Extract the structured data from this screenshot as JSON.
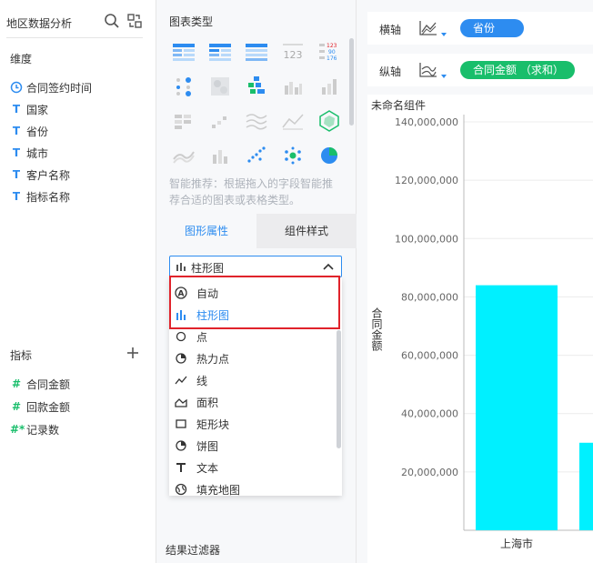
{
  "left": {
    "title": "地区数据分析",
    "dimensions_label": "维度",
    "dimensions": [
      {
        "name": "合同签约时间",
        "type": "clock-icon"
      },
      {
        "name": "国家",
        "type": "text-type-icon"
      },
      {
        "name": "省份",
        "type": "text-type-icon"
      },
      {
        "name": "城市",
        "type": "text-type-icon"
      },
      {
        "name": "客户名称",
        "type": "text-type-icon"
      },
      {
        "name": "指标名称",
        "type": "text-type-icon"
      }
    ],
    "measures_label": "指标",
    "measures": [
      {
        "name": "合同金额",
        "icon": "#"
      },
      {
        "name": "回款金额",
        "icon": "#"
      },
      {
        "name": "记录数",
        "icon": "#*"
      }
    ]
  },
  "middle": {
    "chart_type_title": "图表类型",
    "recommend_text": "智能推荐：根据拖入的字段智能推荐合适的图表或表格类型。",
    "tabs": [
      {
        "label": "图形属性"
      },
      {
        "label": "组件样式"
      }
    ],
    "select": {
      "value": "柱形图"
    },
    "options": [
      {
        "label": "自动",
        "icon": "auto-icon"
      },
      {
        "label": "柱形图",
        "icon": "bar-chart-icon",
        "selected": true
      },
      {
        "label": "点",
        "icon": "dot-icon"
      },
      {
        "label": "热力点",
        "icon": "heat-dot-icon"
      },
      {
        "label": "线",
        "icon": "line-icon"
      },
      {
        "label": "面积",
        "icon": "area-icon"
      },
      {
        "label": "矩形块",
        "icon": "rect-icon"
      },
      {
        "label": "饼图",
        "icon": "pie-icon"
      },
      {
        "label": "文本",
        "icon": "text-icon"
      },
      {
        "label": "填充地图",
        "icon": "fill-map-icon"
      }
    ],
    "result_filter": "结果过滤器"
  },
  "right": {
    "x_shelf": {
      "label": "横轴",
      "pill": "省份"
    },
    "y_shelf": {
      "label": "纵轴",
      "pill": "合同金额 （求和）"
    },
    "chart_name": "未命名组件"
  },
  "colors": {
    "accent": "#2d8cf0",
    "measure": "#19be6b",
    "bar": "#00f0ff",
    "highlight": "#e0232b"
  },
  "chart_data": {
    "type": "bar",
    "categories": [
      "上海市",
      ""
    ],
    "values": [
      84000000,
      30000000
    ],
    "xlabel": "",
    "ylabel": "合同金额",
    "ylim": [
      0,
      140000000
    ],
    "yticks": [
      {
        "value": 20000000,
        "label": "20,000,000"
      },
      {
        "value": 40000000,
        "label": "40,000,000"
      },
      {
        "value": 60000000,
        "label": "60,000,000"
      },
      {
        "value": 80000000,
        "label": "80,000,000"
      },
      {
        "value": 100000000,
        "label": "100,000,000"
      },
      {
        "value": 120000000,
        "label": "120,000,000"
      },
      {
        "value": 140000000,
        "label": "140,000,000"
      }
    ],
    "grid": true
  }
}
